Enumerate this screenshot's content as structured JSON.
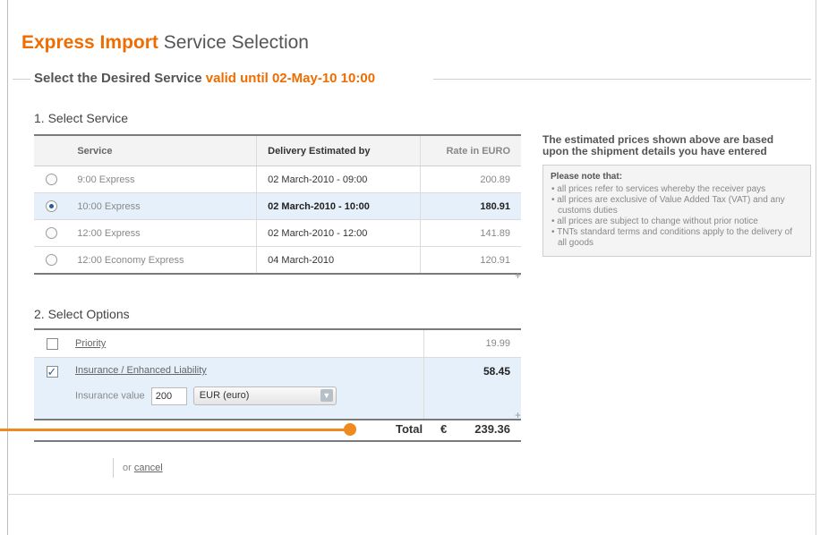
{
  "page": {
    "brand": "Express Import",
    "title": "Service Selection"
  },
  "heading": {
    "text": "Select the Desired Service",
    "valid_label": "valid until",
    "valid_date": "02-May-10 10:00"
  },
  "service_section": {
    "title": "1. Select Service",
    "columns": [
      "Service",
      "Delivery Estimated by",
      "Rate in EURO"
    ],
    "rows": [
      {
        "service": "9:00 Express",
        "delivery": "02 March-2010 - 09:00",
        "rate": "200.89",
        "selected": false
      },
      {
        "service": "10:00 Express",
        "delivery": "02 March-2010 - 10:00",
        "rate": "180.91",
        "selected": true
      },
      {
        "service": "12:00 Express",
        "delivery": "02 March-2010 - 12:00",
        "rate": "141.89",
        "selected": false
      },
      {
        "service": "12:00 Economy Express",
        "delivery": "04 March-2010",
        "rate": "120.91",
        "selected": false
      }
    ]
  },
  "info": {
    "heading": "The estimated prices shown above are based\nupon the shipment details you have entered",
    "note_title": "Please note that:",
    "notes": [
      "• all prices refer to services whereby the receiver pays",
      "• all prices are exclusive of Value Added Tax (VAT) and any customs duties",
      "• all prices are subject to change without prior notice",
      "• TNTs standard terms and conditions apply to the delivery of all goods"
    ]
  },
  "options_section": {
    "title": "2. Select Options",
    "priority": {
      "label": "Priority",
      "price": "19.99",
      "checked": false
    },
    "insurance": {
      "label": "Insurance / Enhanced Liability",
      "price": "58.45",
      "checked": true,
      "value_label": "Insurance value",
      "value": "200",
      "currency": "EUR (euro)"
    }
  },
  "total": {
    "label": "Total",
    "currency_symbol": "€",
    "amount": "239.36"
  },
  "footer": {
    "or_text": "or",
    "cancel_label": "cancel"
  },
  "icons": {
    "dropdown": "chevron-down-icon",
    "checkmark": "checkmark-icon"
  },
  "colors": {
    "accent": "#ef6c00",
    "connector": "#ef8a1f",
    "selected_row": "#e6f0fa"
  }
}
